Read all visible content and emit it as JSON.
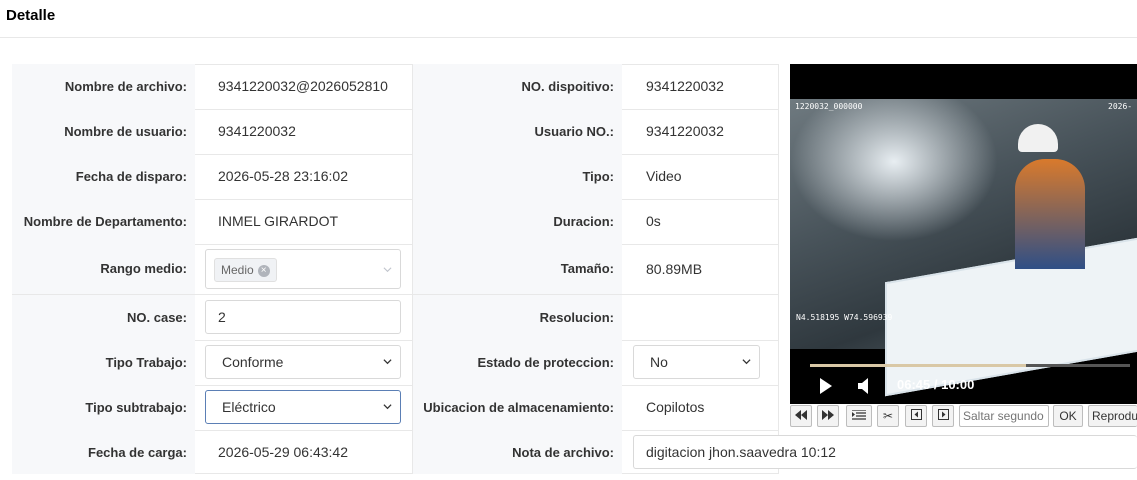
{
  "header": {
    "title": "Detalle"
  },
  "rows": [
    {
      "label1": "Nombre de archivo:",
      "value1": "9341220032@2026052810",
      "label2": "NO. dispoitivo:",
      "value2": "9341220032"
    },
    {
      "label1": "Nombre de usuario:",
      "value1": "9341220032",
      "label2": "Usuario NO.:",
      "value2": "9341220032"
    },
    {
      "label1": "Fecha de disparo:",
      "value1": "2026-05-28 23:16:02",
      "label2": "Tipo:",
      "value2": "Video"
    },
    {
      "label1": "Nombre de Departamento:",
      "value1": "INMEL GIRARDOT",
      "label2": "Duracion:",
      "value2": "0s"
    },
    {
      "label1": "Rango medio:",
      "value1_tag": "Medio",
      "label2": "Tamaño:",
      "value2": "80.89MB"
    },
    {
      "label1": "NO. case:",
      "value1_input": "2",
      "label2": "Resolucion:",
      "value2": ""
    },
    {
      "label1": "Tipo Trabajo:",
      "value1_select": "Conforme",
      "label2": "Estado de proteccion:",
      "value2_select": "No"
    },
    {
      "label1": "Tipo subtrabajo:",
      "value1_select": "Eléctrico",
      "label2": "Ubicacion de almacenamiento:",
      "value2": "Copilotos"
    },
    {
      "label1": "Fecha de carga:",
      "value1": "2026-05-29 06:43:42",
      "label2": "Nota de archivo:",
      "value2_input": "digitacion jhon.saavedra 10:12"
    }
  ],
  "video": {
    "overlay_top_left": "1220032_000000",
    "overlay_top_right": "2026-",
    "overlay_gps": "N4.518195 W74.596939",
    "time": "06:45 / 10:00",
    "progress": 0.675
  },
  "toolbar": {
    "seek_placeholder": "Saltar segundo",
    "ok_label": "OK",
    "play_label": "Reproducir"
  },
  "icons": {
    "play": "play-icon",
    "volume": "volume-icon",
    "rewind": "rewind-icon",
    "forward": "fast-forward-icon",
    "list": "list-icon",
    "cut": "scissors-icon",
    "prev": "prev-frame-icon",
    "next": "next-frame-icon",
    "clear": "clear-icon",
    "chevron": "chevron-down-icon"
  }
}
